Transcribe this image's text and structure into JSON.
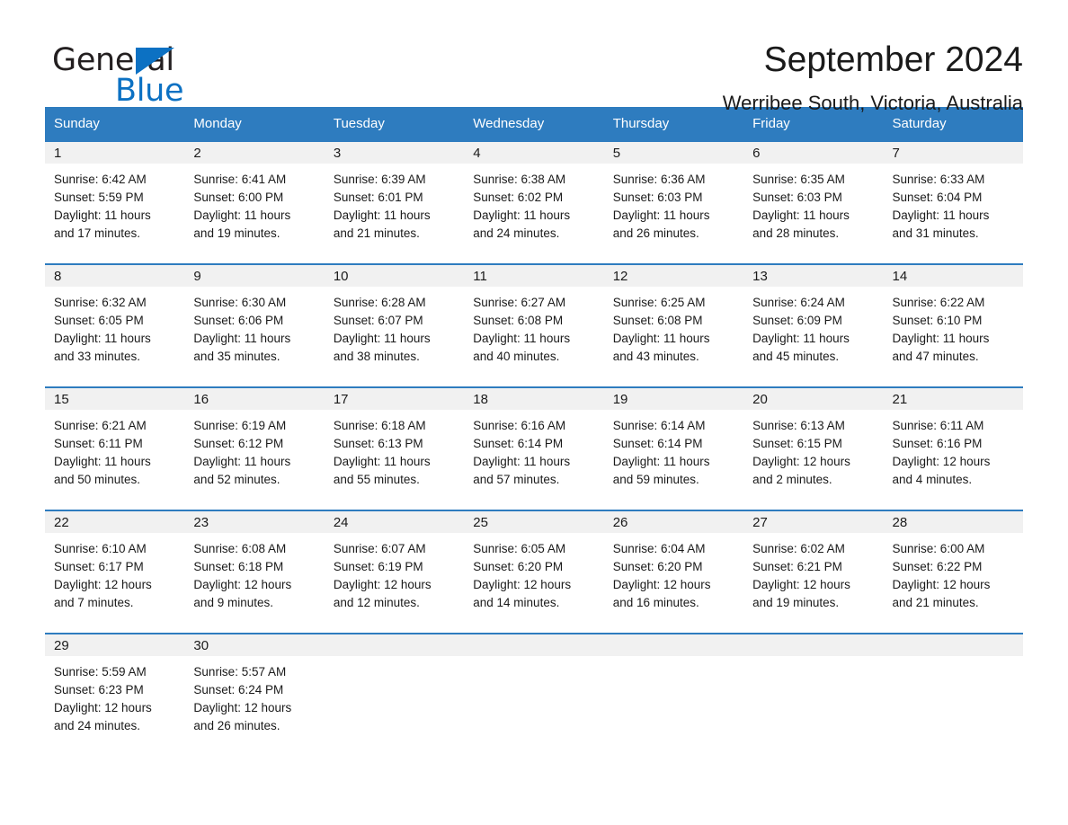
{
  "logo": {
    "word_one": "General",
    "word_two": "Blue",
    "triangle_icon": "triangle-icon",
    "colors": {
      "blue": "#0c71c3",
      "black": "#231f20"
    }
  },
  "header": {
    "title": "September 2024",
    "location": "Werribee South, Victoria, Australia"
  },
  "theme": {
    "header_blue": "#2e7cbf",
    "daynum_band": "#f1f1f1",
    "text": "#1a1a1a"
  },
  "calendar": {
    "weekday_headers": [
      "Sunday",
      "Monday",
      "Tuesday",
      "Wednesday",
      "Thursday",
      "Friday",
      "Saturday"
    ],
    "weeks": [
      [
        {
          "day": "1",
          "sunrise": "Sunrise: 6:42 AM",
          "sunset": "Sunset: 5:59 PM",
          "daylight_1": "Daylight: 11 hours",
          "daylight_2": "and 17 minutes."
        },
        {
          "day": "2",
          "sunrise": "Sunrise: 6:41 AM",
          "sunset": "Sunset: 6:00 PM",
          "daylight_1": "Daylight: 11 hours",
          "daylight_2": "and 19 minutes."
        },
        {
          "day": "3",
          "sunrise": "Sunrise: 6:39 AM",
          "sunset": "Sunset: 6:01 PM",
          "daylight_1": "Daylight: 11 hours",
          "daylight_2": "and 21 minutes."
        },
        {
          "day": "4",
          "sunrise": "Sunrise: 6:38 AM",
          "sunset": "Sunset: 6:02 PM",
          "daylight_1": "Daylight: 11 hours",
          "daylight_2": "and 24 minutes."
        },
        {
          "day": "5",
          "sunrise": "Sunrise: 6:36 AM",
          "sunset": "Sunset: 6:03 PM",
          "daylight_1": "Daylight: 11 hours",
          "daylight_2": "and 26 minutes."
        },
        {
          "day": "6",
          "sunrise": "Sunrise: 6:35 AM",
          "sunset": "Sunset: 6:03 PM",
          "daylight_1": "Daylight: 11 hours",
          "daylight_2": "and 28 minutes."
        },
        {
          "day": "7",
          "sunrise": "Sunrise: 6:33 AM",
          "sunset": "Sunset: 6:04 PM",
          "daylight_1": "Daylight: 11 hours",
          "daylight_2": "and 31 minutes."
        }
      ],
      [
        {
          "day": "8",
          "sunrise": "Sunrise: 6:32 AM",
          "sunset": "Sunset: 6:05 PM",
          "daylight_1": "Daylight: 11 hours",
          "daylight_2": "and 33 minutes."
        },
        {
          "day": "9",
          "sunrise": "Sunrise: 6:30 AM",
          "sunset": "Sunset: 6:06 PM",
          "daylight_1": "Daylight: 11 hours",
          "daylight_2": "and 35 minutes."
        },
        {
          "day": "10",
          "sunrise": "Sunrise: 6:28 AM",
          "sunset": "Sunset: 6:07 PM",
          "daylight_1": "Daylight: 11 hours",
          "daylight_2": "and 38 minutes."
        },
        {
          "day": "11",
          "sunrise": "Sunrise: 6:27 AM",
          "sunset": "Sunset: 6:08 PM",
          "daylight_1": "Daylight: 11 hours",
          "daylight_2": "and 40 minutes."
        },
        {
          "day": "12",
          "sunrise": "Sunrise: 6:25 AM",
          "sunset": "Sunset: 6:08 PM",
          "daylight_1": "Daylight: 11 hours",
          "daylight_2": "and 43 minutes."
        },
        {
          "day": "13",
          "sunrise": "Sunrise: 6:24 AM",
          "sunset": "Sunset: 6:09 PM",
          "daylight_1": "Daylight: 11 hours",
          "daylight_2": "and 45 minutes."
        },
        {
          "day": "14",
          "sunrise": "Sunrise: 6:22 AM",
          "sunset": "Sunset: 6:10 PM",
          "daylight_1": "Daylight: 11 hours",
          "daylight_2": "and 47 minutes."
        }
      ],
      [
        {
          "day": "15",
          "sunrise": "Sunrise: 6:21 AM",
          "sunset": "Sunset: 6:11 PM",
          "daylight_1": "Daylight: 11 hours",
          "daylight_2": "and 50 minutes."
        },
        {
          "day": "16",
          "sunrise": "Sunrise: 6:19 AM",
          "sunset": "Sunset: 6:12 PM",
          "daylight_1": "Daylight: 11 hours",
          "daylight_2": "and 52 minutes."
        },
        {
          "day": "17",
          "sunrise": "Sunrise: 6:18 AM",
          "sunset": "Sunset: 6:13 PM",
          "daylight_1": "Daylight: 11 hours",
          "daylight_2": "and 55 minutes."
        },
        {
          "day": "18",
          "sunrise": "Sunrise: 6:16 AM",
          "sunset": "Sunset: 6:14 PM",
          "daylight_1": "Daylight: 11 hours",
          "daylight_2": "and 57 minutes."
        },
        {
          "day": "19",
          "sunrise": "Sunrise: 6:14 AM",
          "sunset": "Sunset: 6:14 PM",
          "daylight_1": "Daylight: 11 hours",
          "daylight_2": "and 59 minutes."
        },
        {
          "day": "20",
          "sunrise": "Sunrise: 6:13 AM",
          "sunset": "Sunset: 6:15 PM",
          "daylight_1": "Daylight: 12 hours",
          "daylight_2": "and 2 minutes."
        },
        {
          "day": "21",
          "sunrise": "Sunrise: 6:11 AM",
          "sunset": "Sunset: 6:16 PM",
          "daylight_1": "Daylight: 12 hours",
          "daylight_2": "and 4 minutes."
        }
      ],
      [
        {
          "day": "22",
          "sunrise": "Sunrise: 6:10 AM",
          "sunset": "Sunset: 6:17 PM",
          "daylight_1": "Daylight: 12 hours",
          "daylight_2": "and 7 minutes."
        },
        {
          "day": "23",
          "sunrise": "Sunrise: 6:08 AM",
          "sunset": "Sunset: 6:18 PM",
          "daylight_1": "Daylight: 12 hours",
          "daylight_2": "and 9 minutes."
        },
        {
          "day": "24",
          "sunrise": "Sunrise: 6:07 AM",
          "sunset": "Sunset: 6:19 PM",
          "daylight_1": "Daylight: 12 hours",
          "daylight_2": "and 12 minutes."
        },
        {
          "day": "25",
          "sunrise": "Sunrise: 6:05 AM",
          "sunset": "Sunset: 6:20 PM",
          "daylight_1": "Daylight: 12 hours",
          "daylight_2": "and 14 minutes."
        },
        {
          "day": "26",
          "sunrise": "Sunrise: 6:04 AM",
          "sunset": "Sunset: 6:20 PM",
          "daylight_1": "Daylight: 12 hours",
          "daylight_2": "and 16 minutes."
        },
        {
          "day": "27",
          "sunrise": "Sunrise: 6:02 AM",
          "sunset": "Sunset: 6:21 PM",
          "daylight_1": "Daylight: 12 hours",
          "daylight_2": "and 19 minutes."
        },
        {
          "day": "28",
          "sunrise": "Sunrise: 6:00 AM",
          "sunset": "Sunset: 6:22 PM",
          "daylight_1": "Daylight: 12 hours",
          "daylight_2": "and 21 minutes."
        }
      ],
      [
        {
          "day": "29",
          "sunrise": "Sunrise: 5:59 AM",
          "sunset": "Sunset: 6:23 PM",
          "daylight_1": "Daylight: 12 hours",
          "daylight_2": "and 24 minutes."
        },
        {
          "day": "30",
          "sunrise": "Sunrise: 5:57 AM",
          "sunset": "Sunset: 6:24 PM",
          "daylight_1": "Daylight: 12 hours",
          "daylight_2": "and 26 minutes."
        },
        {
          "day": "",
          "sunrise": "",
          "sunset": "",
          "daylight_1": "",
          "daylight_2": ""
        },
        {
          "day": "",
          "sunrise": "",
          "sunset": "",
          "daylight_1": "",
          "daylight_2": ""
        },
        {
          "day": "",
          "sunrise": "",
          "sunset": "",
          "daylight_1": "",
          "daylight_2": ""
        },
        {
          "day": "",
          "sunrise": "",
          "sunset": "",
          "daylight_1": "",
          "daylight_2": ""
        },
        {
          "day": "",
          "sunrise": "",
          "sunset": "",
          "daylight_1": "",
          "daylight_2": ""
        }
      ]
    ]
  }
}
